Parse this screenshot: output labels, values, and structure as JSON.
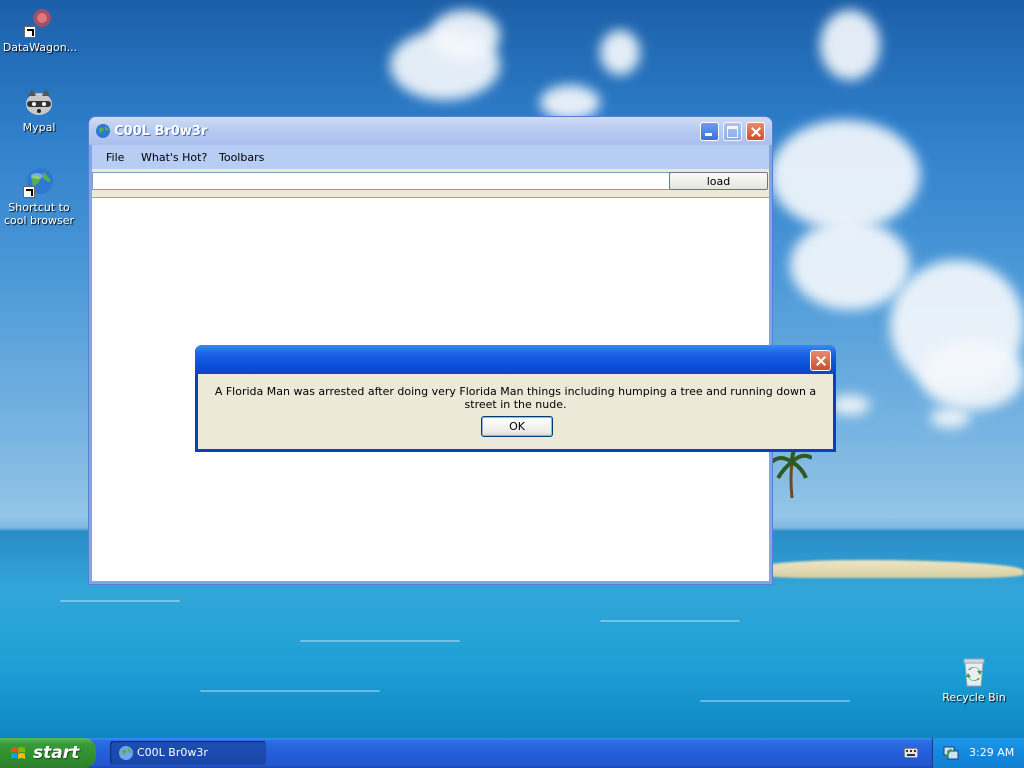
{
  "desktop": {
    "icons": [
      {
        "label": "DataWagon..."
      },
      {
        "label": "Mypal"
      },
      {
        "label": "Shortcut to cool browser"
      },
      {
        "label": "Recycle Bin"
      }
    ]
  },
  "browser": {
    "title": "C00L Br0w3r",
    "menu": [
      "File",
      "What's Hot?",
      "Toolbars"
    ],
    "url_value": "",
    "load_label": "load"
  },
  "dialog": {
    "title": "",
    "message": "A Florida Man was arrested after doing very Florida Man things including humping a tree and running down a street in the nude.",
    "ok_label": "OK"
  },
  "taskbar": {
    "start_label": "start",
    "tasks": [
      {
        "label": "C00L Br0w3r"
      }
    ],
    "clock": "3:29 AM"
  },
  "colors": {
    "xp_blue": "#0a4fd8",
    "start_green": "#3a9a3a",
    "dialog_face": "#ece9d8",
    "close_red": "#c9502f"
  }
}
